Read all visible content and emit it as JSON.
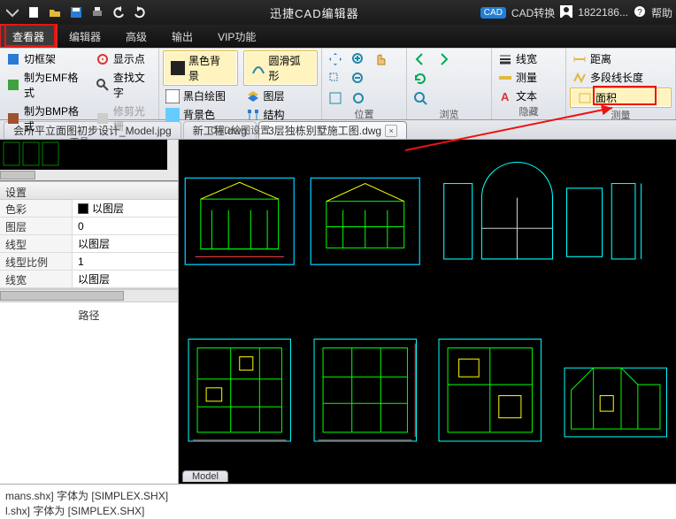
{
  "titlebar": {
    "app_title": "迅捷CAD编辑器",
    "cad_convert": "CAD转换",
    "user_id": "1822186...",
    "help": "帮助"
  },
  "menubar": {
    "items": [
      "查看器",
      "编辑器",
      "高级",
      "输出",
      "VIP功能"
    ]
  },
  "ribbon": {
    "group_tools": {
      "label": "工具",
      "items": [
        "切框架",
        "制为EMF格式",
        "制为BMP格式"
      ],
      "col2": [
        "显示点",
        "查找文字",
        "修剪光栅"
      ]
    },
    "group_draw": {
      "label": "CAD绘图设置",
      "items": [
        "黑色背景",
        "黑白绘图",
        "背景色"
      ],
      "col2": [
        "圆滑弧形",
        "图层",
        "结构"
      ]
    },
    "group_pos": {
      "label": "位置"
    },
    "group_browse": {
      "label": "浏览"
    },
    "group_hide": {
      "label": "隐藏",
      "items": [
        "线宽",
        "测量",
        "文本"
      ]
    },
    "group_measure": {
      "label": "测量",
      "items": [
        "距离",
        "多段线长度",
        "面积"
      ]
    }
  },
  "doctabs": {
    "tabs": [
      {
        "label": "会所平立面图初步设计_Model.jpg"
      },
      {
        "label": "新工程.dwg"
      },
      {
        "label": "3层独栋别墅施工图.dwg"
      }
    ]
  },
  "properties": {
    "header": "设置",
    "rows": [
      {
        "label": "色彩",
        "value": "以图层",
        "swatch": true
      },
      {
        "label": "图层",
        "value": "0"
      },
      {
        "label": "线型",
        "value": "以图层"
      },
      {
        "label": "线型比例",
        "value": "1"
      },
      {
        "label": "线宽",
        "value": "以图层"
      }
    ]
  },
  "path_panel": {
    "header": "路径"
  },
  "model_tab": "Model",
  "console": {
    "line1": "mans.shx] 字体为 [SIMPLEX.SHX]",
    "line2": "l.shx] 字体为 [SIMPLEX.SHX]"
  }
}
